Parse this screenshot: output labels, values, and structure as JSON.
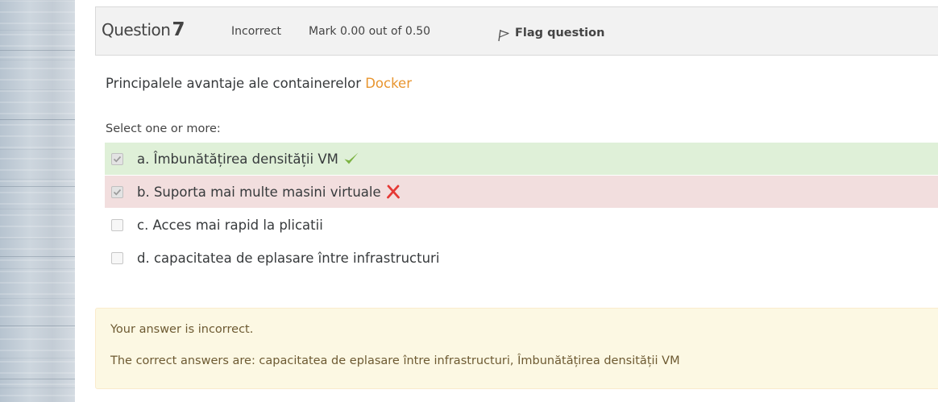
{
  "question": {
    "label": "Question",
    "number": "7",
    "state": "Incorrect",
    "grade": "Mark 0.00 out of 0.50",
    "flag_label": "Flag question",
    "text_prefix": "Principalele avantaje ale containerelor ",
    "text_highlight": "Docker",
    "prompt": "Select one or more:"
  },
  "answers": [
    {
      "label": "a. Îmbunătățirea densității VM",
      "checked": true,
      "result": "correct",
      "icon": "check-icon"
    },
    {
      "label": "b. Suporta mai multe masini virtuale",
      "checked": true,
      "result": "incorrect",
      "icon": "cross-icon"
    },
    {
      "label": "c. Acces mai rapid la plicatii",
      "checked": false,
      "result": "none"
    },
    {
      "label": "d. capacitatea de eplasare între infrastructuri",
      "checked": false,
      "result": "none"
    }
  ],
  "feedback": {
    "line1": "Your answer is incorrect.",
    "line2": "The correct answers are: capacitatea de eplasare între infrastructuri, Îmbunătățirea densității VM"
  },
  "colors": {
    "accent": "#e8952f",
    "correct_bg": "#dff0d8",
    "incorrect_bg": "#f2dede",
    "feedback_bg": "#fcf8e3",
    "check_green": "#7cb342",
    "cross_red": "#e53935"
  }
}
